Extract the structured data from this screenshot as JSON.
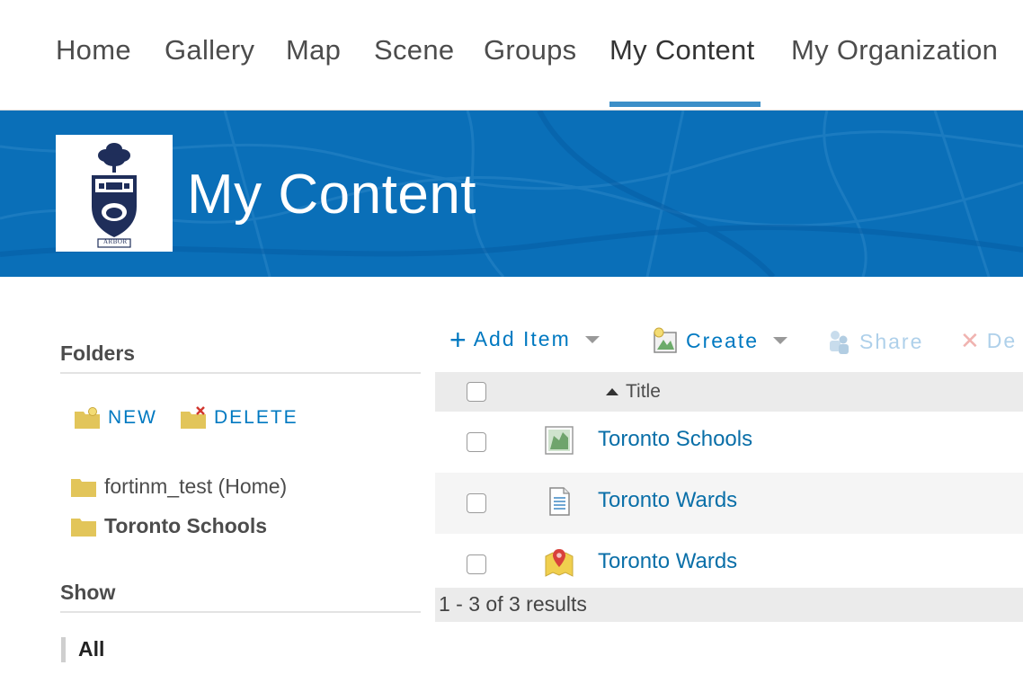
{
  "nav": {
    "items": [
      {
        "label": "Home"
      },
      {
        "label": "Gallery"
      },
      {
        "label": "Map"
      },
      {
        "label": "Scene"
      },
      {
        "label": "Groups"
      },
      {
        "label": "My Content"
      },
      {
        "label": "My Organization"
      }
    ],
    "active": "My Content"
  },
  "banner": {
    "title": "My Content",
    "logo_icon": "university-crest-logo",
    "logo_text": "ARBOR",
    "background_color": "#0a6fb8"
  },
  "sidebar": {
    "folders_heading": "Folders",
    "new_label": "NEW",
    "delete_label": "DELETE",
    "folders": [
      {
        "name": "fortinm_test (Home)",
        "selected": false
      },
      {
        "name": "Toronto Schools",
        "selected": true
      }
    ],
    "show_heading": "Show",
    "show_items": [
      {
        "label": "All",
        "selected": true
      }
    ]
  },
  "toolbar": {
    "add_item": "Add Item",
    "create": "Create",
    "share": "Share",
    "delete": "De"
  },
  "table": {
    "title_header": "Title",
    "rows": [
      {
        "title": "Toronto Schools",
        "icon": "web-map-icon"
      },
      {
        "title": "Toronto Wards",
        "icon": "document-icon"
      },
      {
        "title": "Toronto Wards",
        "icon": "feature-layer-icon"
      }
    ],
    "results": "1 - 3 of 3 results"
  },
  "colors": {
    "accent": "#0079c1",
    "link": "#0a6fa8",
    "nav_underline": "#3c8fc8",
    "folder": "#e2c55a"
  }
}
